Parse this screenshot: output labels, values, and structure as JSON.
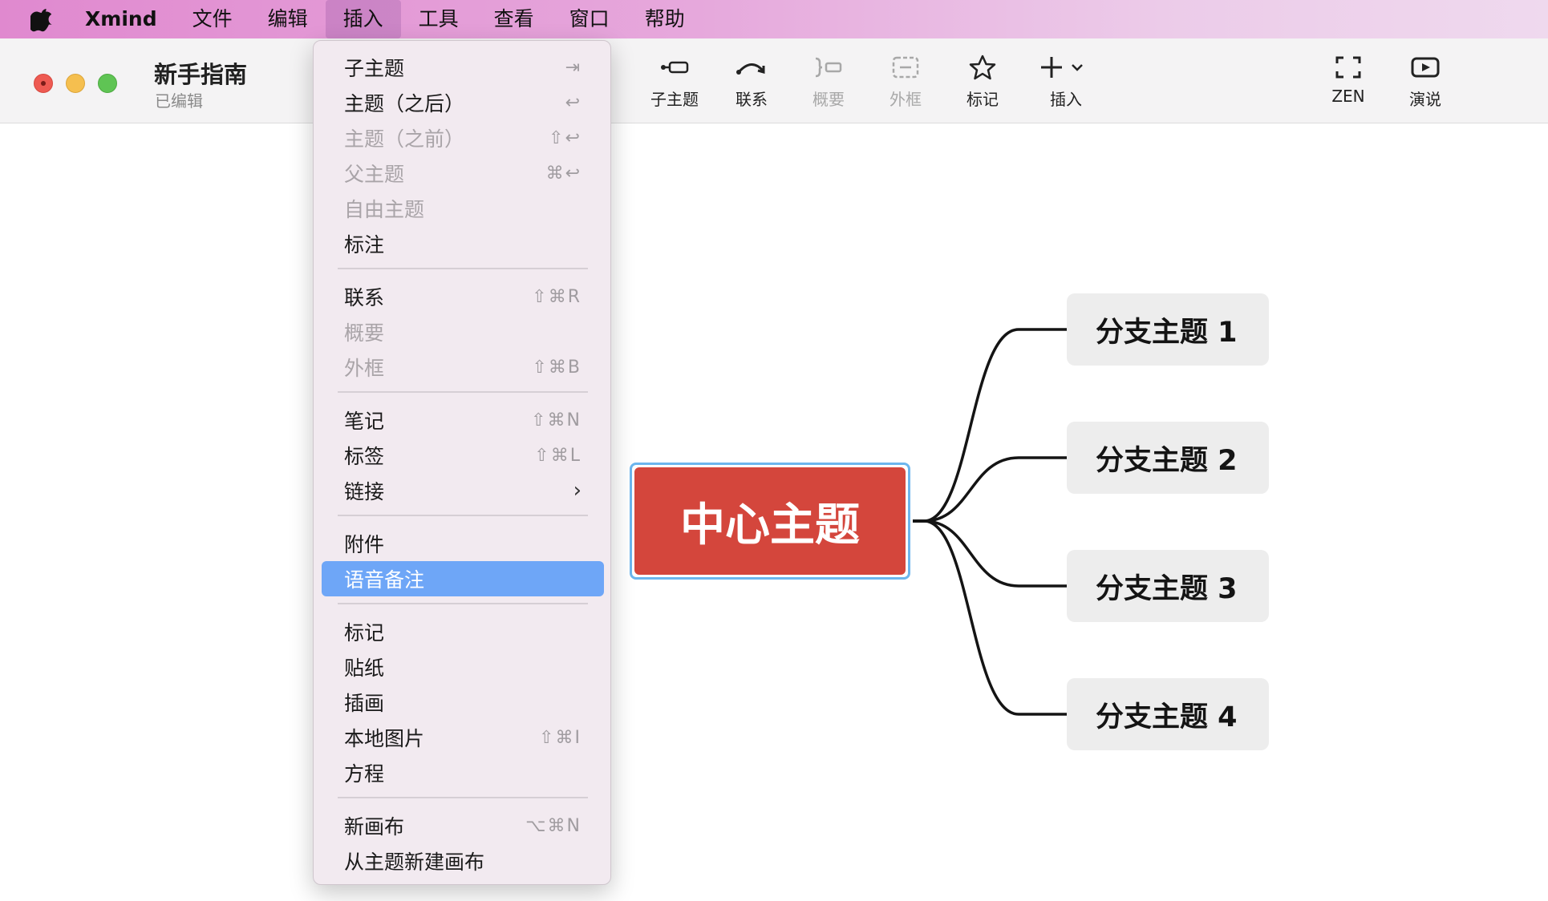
{
  "menubar": {
    "app_name": "Xmind",
    "items": [
      "文件",
      "编辑",
      "插入",
      "工具",
      "查看",
      "窗口",
      "帮助"
    ],
    "active_index": 2
  },
  "window": {
    "title": "新手指南",
    "status": "已编辑"
  },
  "toolbar": {
    "tools": [
      {
        "label": "子主题",
        "icon": "subtopic-icon",
        "disabled": false
      },
      {
        "label": "联系",
        "icon": "relationship-icon",
        "disabled": false
      },
      {
        "label": "概要",
        "icon": "summary-icon",
        "disabled": true
      },
      {
        "label": "外框",
        "icon": "boundary-icon",
        "disabled": true
      },
      {
        "label": "标记",
        "icon": "star-icon",
        "disabled": false
      },
      {
        "label": "插入",
        "icon": "plus-icon",
        "disabled": false
      },
      {
        "label": "ZEN",
        "icon": "zen-icon",
        "disabled": false
      },
      {
        "label": "演说",
        "icon": "play-icon",
        "disabled": false
      }
    ]
  },
  "mindmap": {
    "center": "中心主题",
    "branches": [
      "分支主题 1",
      "分支主题 2",
      "分支主题 3",
      "分支主题 4"
    ],
    "center_color": "#d4463c",
    "selection_color": "#6cb6ee"
  },
  "insert_menu": {
    "items": [
      {
        "label": "子主题",
        "shortcut": "⇥",
        "disabled": false
      },
      {
        "label": "主题（之后）",
        "shortcut": "↩",
        "disabled": false
      },
      {
        "label": "主题（之前）",
        "shortcut": "⇧↩",
        "disabled": true
      },
      {
        "label": "父主题",
        "shortcut": "⌘↩",
        "disabled": true
      },
      {
        "label": "自由主题",
        "shortcut": "",
        "disabled": true
      },
      {
        "label": "标注",
        "shortcut": "",
        "disabled": false
      },
      {
        "label": "联系",
        "shortcut": "⇧⌘R",
        "disabled": false
      },
      {
        "label": "概要",
        "shortcut": "",
        "disabled": true
      },
      {
        "label": "外框",
        "shortcut": "⇧⌘B",
        "disabled": true
      },
      {
        "label": "笔记",
        "shortcut": "⇧⌘N",
        "disabled": false
      },
      {
        "label": "标签",
        "shortcut": "⇧⌘L",
        "disabled": false
      },
      {
        "label": "链接",
        "shortcut": "›",
        "disabled": false
      },
      {
        "label": "附件",
        "shortcut": "",
        "disabled": false
      },
      {
        "label": "语音备注",
        "shortcut": "",
        "disabled": false,
        "highlighted": true
      },
      {
        "label": "标记",
        "shortcut": "",
        "disabled": false
      },
      {
        "label": "贴纸",
        "shortcut": "",
        "disabled": false
      },
      {
        "label": "插画",
        "shortcut": "",
        "disabled": false
      },
      {
        "label": "本地图片",
        "shortcut": "⇧⌘I",
        "disabled": false
      },
      {
        "label": "方程",
        "shortcut": "",
        "disabled": false
      },
      {
        "label": "新画布",
        "shortcut": "⌥⌘N",
        "disabled": false
      },
      {
        "label": "从主题新建画布",
        "shortcut": "",
        "disabled": false
      }
    ]
  }
}
